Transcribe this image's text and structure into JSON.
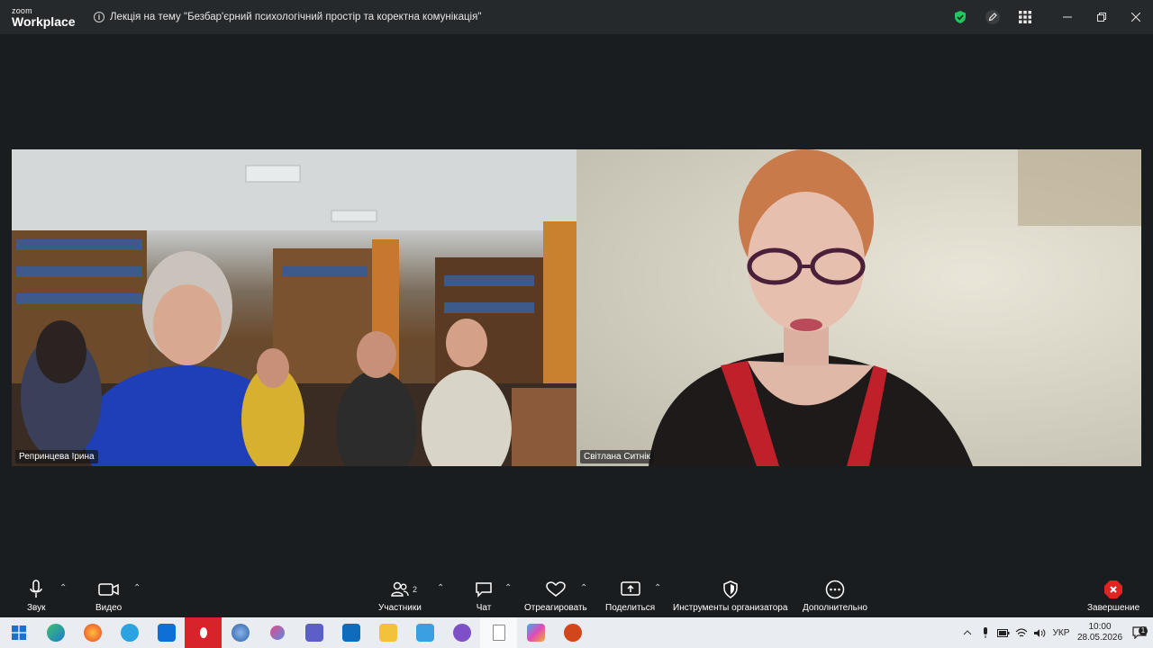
{
  "titlebar": {
    "brand_top": "zoom",
    "brand_bottom": "Workplace",
    "meeting_title": "Лекція на тему \"Безбар'єрний психологічний простір та коректна комунікація\"",
    "icons": [
      "shield-check-icon",
      "pencil-icon",
      "grid-icon",
      "minimize-icon",
      "restore-icon",
      "close-icon"
    ]
  },
  "participants": [
    {
      "name": "Репринцева Ірина"
    },
    {
      "name": "Світлана Ситнік"
    }
  ],
  "toolbar": {
    "audio_label": "Звук",
    "video_label": "Видео",
    "participants_label": "Участники",
    "participants_count": "2",
    "chat_label": "Чат",
    "react_label": "Отреагировать",
    "share_label": "Поделиться",
    "host_tools_label": "Инструменты организатора",
    "more_label": "Дополнительно",
    "end_label": "Завершение"
  },
  "taskbar": {
    "apps": [
      "windows",
      "edge",
      "firefox",
      "telegram",
      "teamviewer",
      "opera",
      "globe",
      "snipping",
      "teams",
      "outlook",
      "explorer",
      "photos",
      "viber",
      "notepad",
      "copilot",
      "powerpoint"
    ],
    "language": "УКР",
    "time": "10:00",
    "date": "28.05.2026",
    "notification_count": "1"
  },
  "colors": {
    "accent_green": "#23c55e",
    "end_red": "#e02424",
    "bg": "#1a1d1f"
  }
}
